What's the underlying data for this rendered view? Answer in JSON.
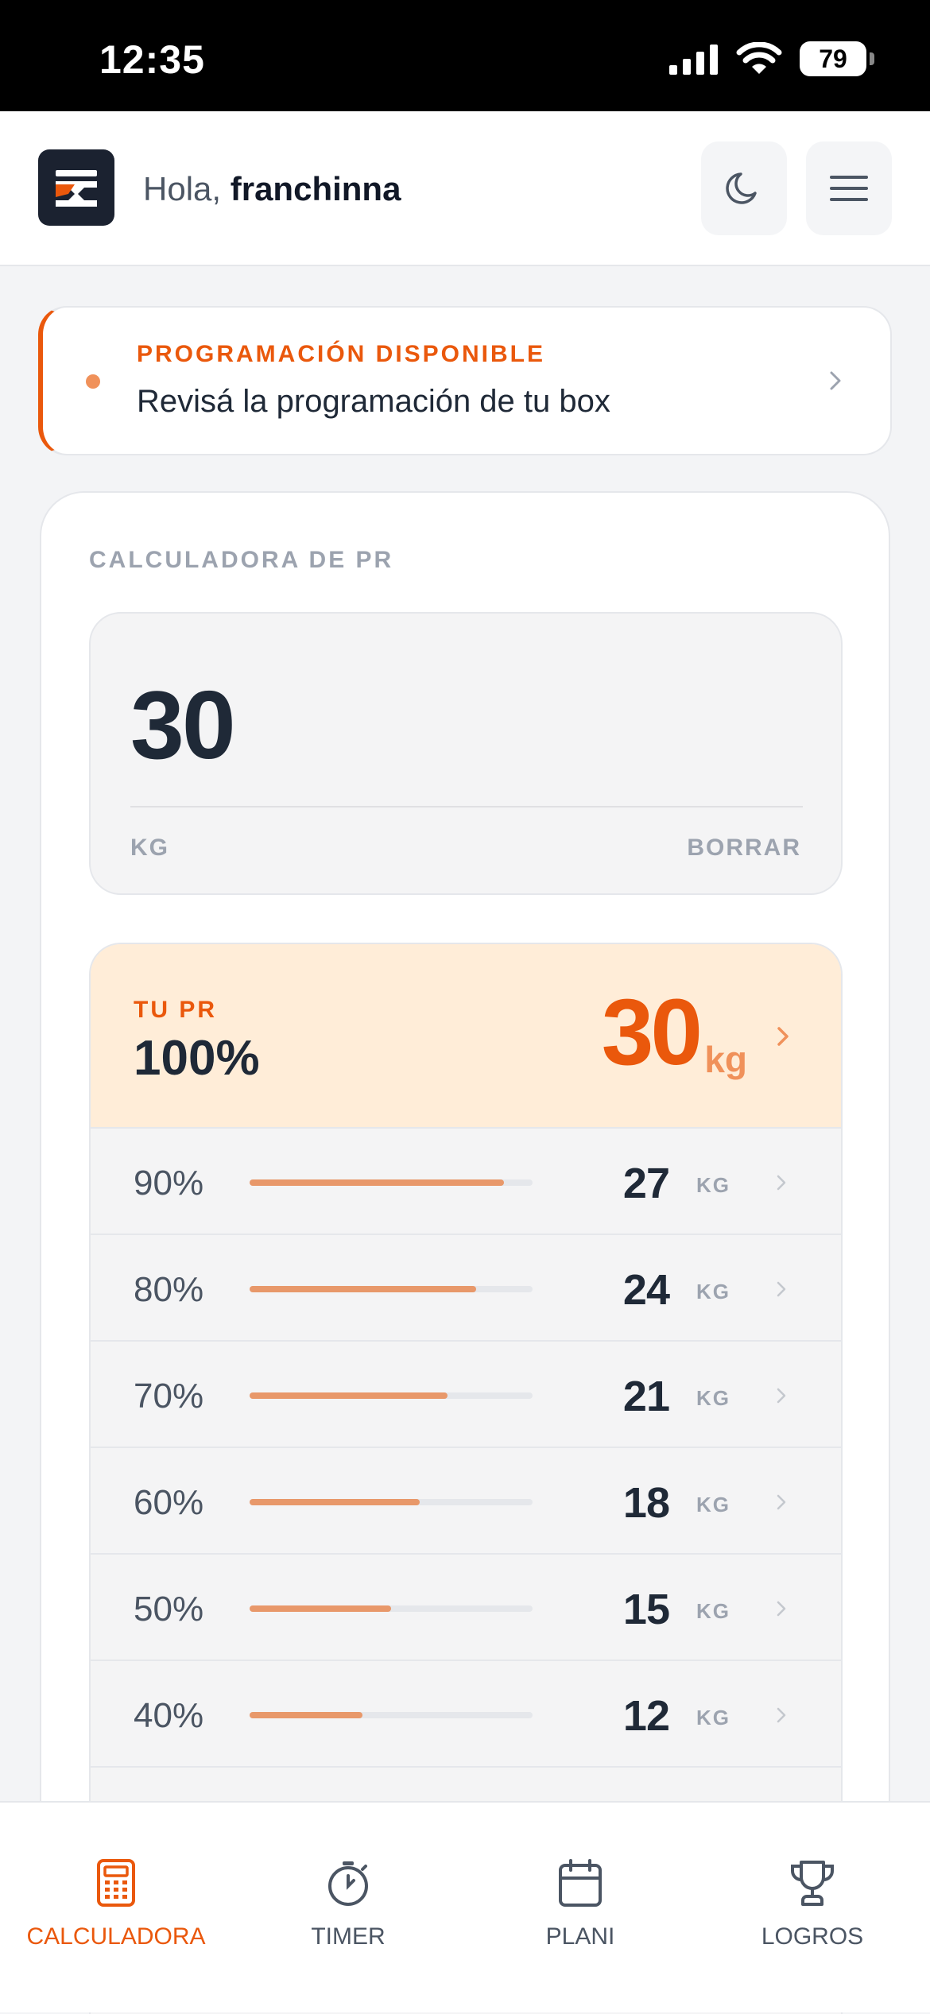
{
  "status_bar": {
    "time": "12:35",
    "battery": "79"
  },
  "header": {
    "greeting": "Hola,",
    "username": "franchinna"
  },
  "notice": {
    "title": "PROGRAMACIÓN DISPONIBLE",
    "text": "Revisá la programación de tu box"
  },
  "calculator": {
    "title": "CALCULADORA DE PR",
    "input_value": "30",
    "input_unit": "KG",
    "clear_label": "BORRAR",
    "pr": {
      "label": "TU PR",
      "percent": "100%",
      "value": "30",
      "unit": "kg"
    },
    "rows": [
      {
        "percent": "90%",
        "fraction": 0.9,
        "value": "27",
        "unit": "KG"
      },
      {
        "percent": "80%",
        "fraction": 0.8,
        "value": "24",
        "unit": "KG"
      },
      {
        "percent": "70%",
        "fraction": 0.7,
        "value": "21",
        "unit": "KG"
      },
      {
        "percent": "60%",
        "fraction": 0.6,
        "value": "18",
        "unit": "KG"
      },
      {
        "percent": "50%",
        "fraction": 0.5,
        "value": "15",
        "unit": "KG"
      },
      {
        "percent": "40%",
        "fraction": 0.4,
        "value": "12",
        "unit": "KG"
      }
    ]
  },
  "nav": {
    "calculadora": "CALCULADORA",
    "timer": "TIMER",
    "plani": "PLANI",
    "logros": "LOGROS"
  },
  "colors": {
    "accent": "#ea580c",
    "bar": "#e8986a",
    "pr_bg": "#ffedd8"
  }
}
